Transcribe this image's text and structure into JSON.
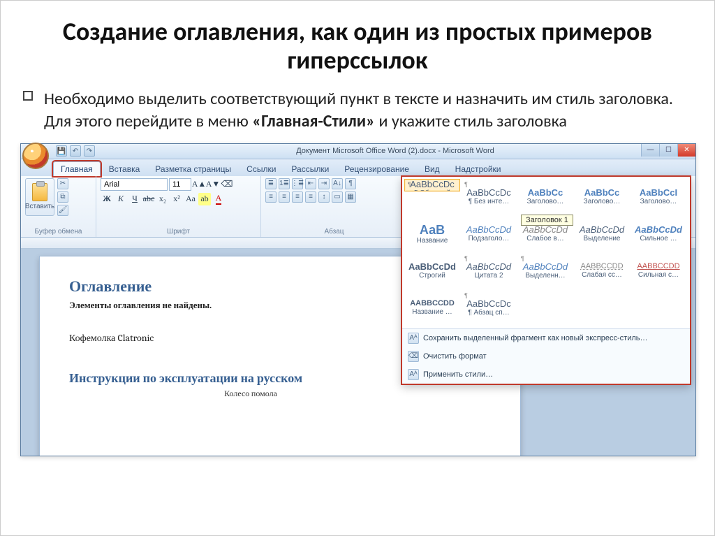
{
  "slide": {
    "title": "Создание оглавления, как один из простых примеров гиперссылок",
    "body_pre": "Необходимо выделить соответствующий пункт в тексте и назначить им стиль заголовка. Для этого перейдите в меню ",
    "body_bold": "«Главная-Стили»",
    "body_post": " и укажите стиль заголовка"
  },
  "window": {
    "doc_title": "Документ Microsoft Office Word (2).docx - Microsoft Word",
    "qat": {
      "save": "💾",
      "undo": "↶",
      "redo": "↷"
    },
    "win": {
      "min": "—",
      "max": "☐",
      "close": "✕"
    }
  },
  "tabs": [
    "Главная",
    "Вставка",
    "Разметка страницы",
    "Ссылки",
    "Рассылки",
    "Рецензирование",
    "Вид",
    "Надстройки"
  ],
  "ribbon": {
    "clipboard": {
      "paste": "Вставить",
      "label": "Буфер обмена"
    },
    "font": {
      "name": "Arial",
      "size": "11",
      "label": "Шрифт"
    },
    "paragraph": {
      "label": "Абзац"
    },
    "styles": {
      "strip": [
        {
          "sample": "AaBbCcDc",
          "name": "¶ Обычный",
          "cls": ""
        },
        {
          "sample": "AaBbCcDc",
          "name": "¶ Без инте…",
          "cls": ""
        },
        {
          "sample": "AaBbCc",
          "name": "Заголово…",
          "cls": "blue hover"
        },
        {
          "sample": "AaBbCc",
          "name": "Заголово…",
          "cls": "blue"
        },
        {
          "sample": "AaBbCcI",
          "name": "Заголово…",
          "cls": "blue"
        }
      ],
      "tooltip": "Заголовок 1"
    }
  },
  "gallery": {
    "rows": [
      [
        {
          "sample": "AaBbCcDc",
          "name": "¶ Обычный",
          "style": "",
          "para": true,
          "sel": true
        },
        {
          "sample": "AaBbCcDc",
          "name": "¶ Без инте…",
          "style": "",
          "para": true
        },
        {
          "sample": "AaBbCc",
          "name": "Заголово…",
          "style": "color:#4f81bd;font-weight:700"
        },
        {
          "sample": "AaBbCc",
          "name": "Заголово…",
          "style": "color:#4f81bd;font-weight:700"
        },
        {
          "sample": "AaBbCcI",
          "name": "Заголово…",
          "style": "color:#4f81bd;font-weight:700"
        }
      ],
      [
        {
          "sample": "АаВ",
          "name": "Название",
          "style": "color:#4f81bd;font-size:18px;font-weight:700"
        },
        {
          "sample": "AaBbCcDd",
          "name": "Подзаголо…",
          "style": "color:#4f81bd;font-style:italic"
        },
        {
          "sample": "AaBbCcDd",
          "name": "Слабое в…",
          "style": "color:#888;font-style:italic"
        },
        {
          "sample": "AaBbCcDd",
          "name": "Выделение",
          "style": "font-style:italic"
        },
        {
          "sample": "AaBbCcDd",
          "name": "Сильное …",
          "style": "color:#4f81bd;font-style:italic;font-weight:700"
        }
      ],
      [
        {
          "sample": "AaBbCcDd",
          "name": "Строгий",
          "style": "font-weight:700"
        },
        {
          "sample": "AaBbCcDd",
          "name": "Цитата 2",
          "style": "font-style:italic",
          "para": true
        },
        {
          "sample": "AaBbCcDd",
          "name": "Выделенн…",
          "style": "color:#4f81bd;font-style:italic",
          "para": true
        },
        {
          "sample": "AABBCCDD",
          "name": "Слабая сс…",
          "style": "color:#888;font-size:11px;text-decoration:underline dotted"
        },
        {
          "sample": "AABBCCDD",
          "name": "Сильная с…",
          "style": "color:#c0504d;font-size:11px;text-decoration:underline"
        }
      ],
      [
        {
          "sample": "AABBCCDD",
          "name": "Название …",
          "style": "font-weight:700;font-size:11px"
        },
        {
          "sample": "AaBbCcDc",
          "name": "¶ Абзац сп…",
          "style": "",
          "para": true
        },
        {
          "empty": true
        },
        {
          "empty": true
        },
        {
          "empty": true
        }
      ]
    ],
    "footer": [
      "Сохранить выделенный фрагмент как новый экспресс-стиль…",
      "Очистить формат",
      "Применить стили…"
    ]
  },
  "document": {
    "h1": "Оглавление",
    "notfound": "Элементы оглавления не найдены.",
    "line1": "Кофемолка Clatronic",
    "h2": "Инструкции по эксплуатации на русском",
    "caption": "Колесо помола"
  }
}
